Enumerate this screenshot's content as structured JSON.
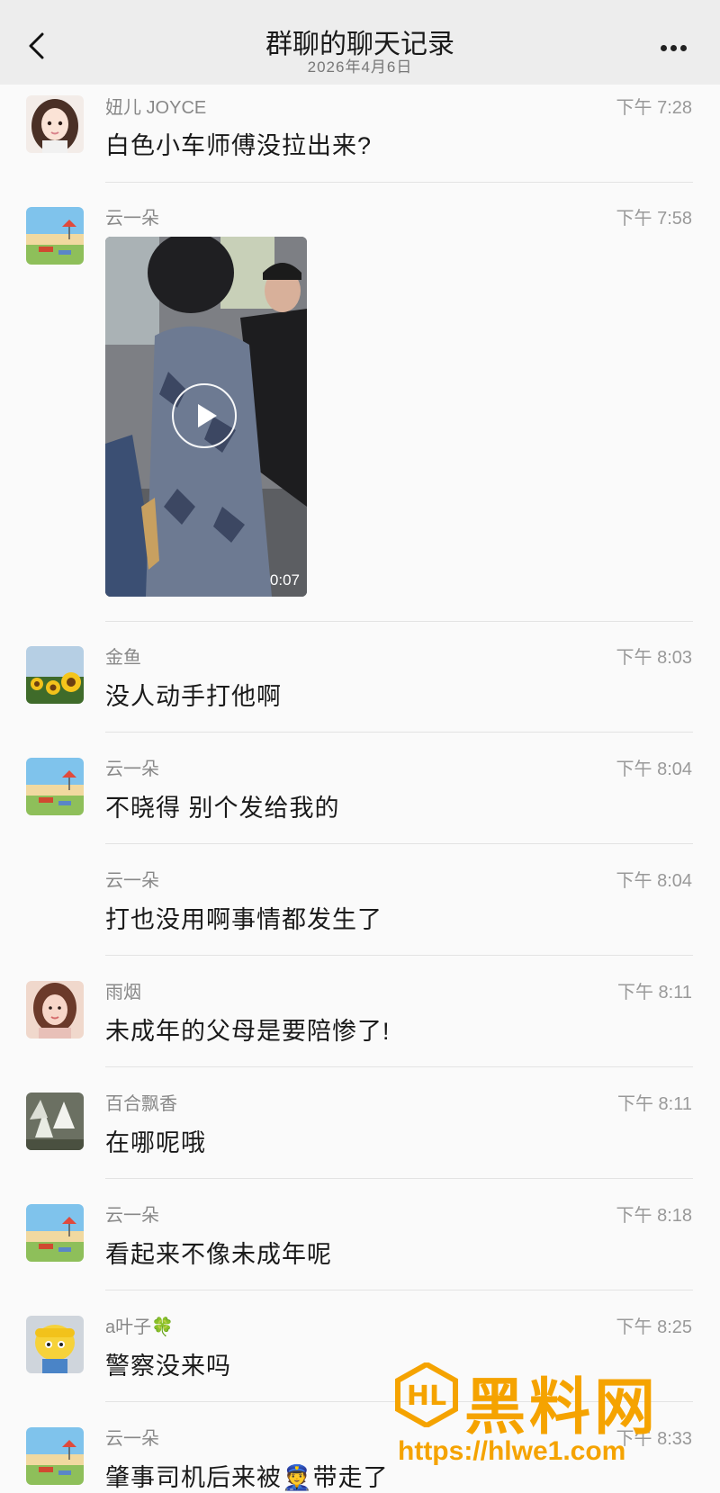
{
  "header": {
    "title": "群聊的聊天记录",
    "date": "2026年4月6日",
    "back_icon": "chevron-left-icon",
    "more_icon": "more-dots-icon"
  },
  "messages": [
    {
      "sender": "妞儿 JOYCE",
      "time": "下午 7:28",
      "text": "白色小车师傅没拉出来?"
    },
    {
      "sender": "云一朵",
      "time": "下午 7:58",
      "video_duration": "0:07"
    },
    {
      "sender": "金鱼",
      "time": "下午 8:03",
      "text": "没人动手打他啊"
    },
    {
      "sender": "云一朵",
      "time": "下午 8:04",
      "text": "不晓得  别个发给我的"
    },
    {
      "sender": "云一朵",
      "time": "下午 8:04",
      "text": "打也没用啊事情都发生了"
    },
    {
      "sender": "雨烟",
      "time": "下午 8:11",
      "text": "未成年的父母是要陪惨了!"
    },
    {
      "sender": "百合飘香",
      "time": "下午 8:11",
      "text": "在哪呢哦"
    },
    {
      "sender": "云一朵",
      "time": "下午 8:18",
      "text": "看起来不像未成年呢"
    },
    {
      "sender": "a叶子🍀",
      "time": "下午 8:25",
      "text": "警察没来吗"
    },
    {
      "sender": "云一朵",
      "time": "下午 8:33",
      "text_before": "肇事司机后来被",
      "emoji": "👮",
      "text_after": "带走了"
    }
  ],
  "watermark": {
    "title": "黑料网",
    "url": "https://hlwe1.com",
    "color": "#f5a300"
  }
}
